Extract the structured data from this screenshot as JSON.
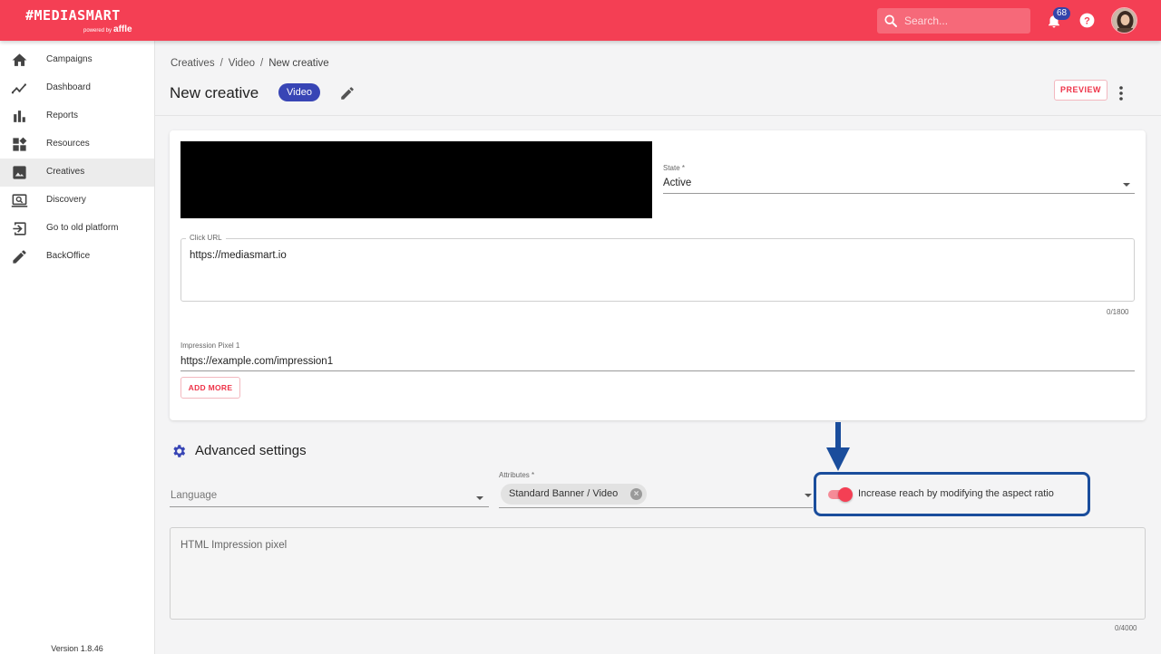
{
  "app": {
    "logo_text": "#MEDIASMART",
    "logo_powered_by": "powered by",
    "logo_affle": "affle"
  },
  "topbar": {
    "search_placeholder": "Search...",
    "notification_count": "68"
  },
  "sidebar": {
    "items": [
      {
        "label": "Campaigns",
        "icon": "home-icon"
      },
      {
        "label": "Dashboard",
        "icon": "trend-icon"
      },
      {
        "label": "Reports",
        "icon": "bar-chart-icon"
      },
      {
        "label": "Resources",
        "icon": "widgets-icon"
      },
      {
        "label": "Creatives",
        "icon": "image-icon",
        "active": true
      },
      {
        "label": "Discovery",
        "icon": "discovery-icon"
      },
      {
        "label": "Go to old platform",
        "icon": "exit-icon"
      },
      {
        "label": "BackOffice",
        "icon": "pencil-icon"
      }
    ],
    "version": "Version 1.8.46"
  },
  "breadcrumb": {
    "items": [
      "Creatives",
      "Video",
      "New creative"
    ],
    "separator": "/"
  },
  "header": {
    "title": "New creative",
    "type_badge": "Video",
    "preview_label": "PREVIEW"
  },
  "form": {
    "state": {
      "label": "State *",
      "value": "Active"
    },
    "click_url": {
      "label": "Click URL",
      "value": "https://mediasmart.io",
      "counter": "0/1800"
    },
    "impression_pixel": {
      "label": "Impression Pixel 1",
      "value": "https://example.com/impression1"
    },
    "add_more_label": "ADD MORE"
  },
  "advanced": {
    "title": "Advanced settings",
    "language_placeholder": "Language",
    "attributes_label": "Attributes *",
    "attributes_chip": "Standard Banner / Video",
    "aspect_toggle_label": "Increase reach by modifying the aspect ratio",
    "aspect_toggle_on": true,
    "html_pixel_placeholder": "HTML Impression pixel",
    "html_pixel_counter": "0/4000"
  },
  "colors": {
    "brand": "#f43f54",
    "badge": "#3845b5",
    "annotation": "#1a4d9c"
  }
}
